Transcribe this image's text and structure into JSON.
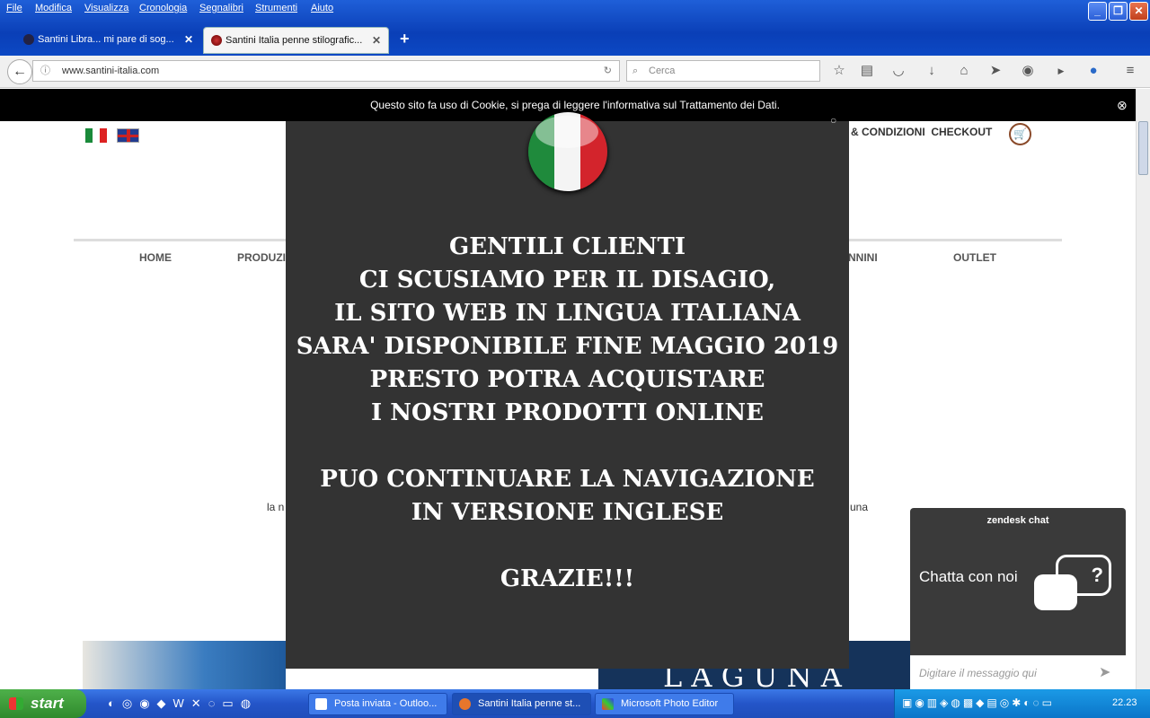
{
  "menu": [
    "File",
    "Modifica",
    "Visualizza",
    "Cronologia",
    "Segnalibri",
    "Strumenti",
    "Aiuto"
  ],
  "window_controls": {
    "minimize": "_",
    "restore": "❐",
    "close": "✕"
  },
  "tabs": [
    {
      "label": "Santini Libra... mi pare di sog...",
      "active": false
    },
    {
      "label": "Santini Italia penne stilografic...",
      "active": true
    }
  ],
  "new_tab_label": "+",
  "url": "www.santini-italia.com",
  "search_placeholder": "Cerca",
  "cookie_notice": "Questo sito fa uso di Cookie, si prega di leggere l'informativa sul Trattamento dei Dati.",
  "header_links": "& CONDIZIONI  CHECKOUT",
  "nav": [
    "HOME",
    "PRODUZI",
    "NNINI",
    "OUTLET"
  ],
  "body_fragments": {
    "left": "la n",
    "right": "una"
  },
  "banner_text": "L A G U N A",
  "modal": {
    "lines1": [
      "GENTILI CLIENTI",
      "CI SCUSIAMO PER IL DISAGIO,",
      "IL SITO WEB IN LINGUA ITALIANA",
      "SARA' DISPONIBILE FINE MAGGIO 2019",
      "PRESTO POTRA ACQUISTARE",
      "I NOSTRI PRODOTTI ONLINE"
    ],
    "lines2": [
      "PUO CONTINUARE LA NAVIGAZIONE",
      "IN VERSIONE INGLESE"
    ],
    "thanks": "GRAZIE!!!"
  },
  "chat": {
    "brand": "zendesk chat",
    "cta": "Chatta con noi",
    "placeholder": "Digitare il messaggio qui"
  },
  "taskbar": {
    "start": "start",
    "tasks": [
      "Posta inviata - Outloo...",
      "Santini Italia penne st...",
      "Microsoft Photo Editor"
    ],
    "clock": "22.23"
  }
}
